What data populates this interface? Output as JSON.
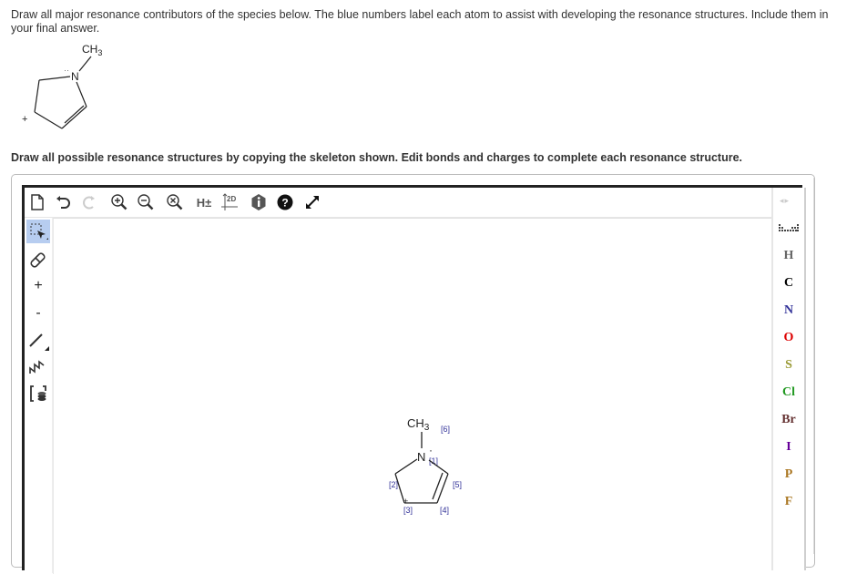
{
  "question": {
    "prompt": "Draw all major resonance contributors of the species below. The blue numbers label each atom to assist with developing the resonance structures. Include them in your final answer.",
    "molecule": {
      "methyl_label": "CH",
      "methyl_sub": "3",
      "nitrogen_label": "N",
      "lone_pair": "··",
      "charge_label": "+"
    }
  },
  "instruction": "Draw all possible resonance structures by copying the skeleton shown. Edit bonds and charges to complete each resonance structure.",
  "editor": {
    "toolbar": [
      {
        "name": "new-document-icon",
        "label": ""
      },
      {
        "name": "undo-icon",
        "label": ""
      },
      {
        "name": "redo-icon",
        "label": ""
      },
      {
        "name": "zoom-in-icon",
        "label": ""
      },
      {
        "name": "zoom-out-icon",
        "label": ""
      },
      {
        "name": "zoom-reset-icon",
        "label": ""
      },
      {
        "name": "toggle-hydrogens-button",
        "label": "H±"
      },
      {
        "name": "clean-2d-icon",
        "label": "2D"
      },
      {
        "name": "info-icon",
        "label": ""
      },
      {
        "name": "help-icon",
        "label": "?"
      },
      {
        "name": "fullscreen-icon",
        "label": ""
      }
    ],
    "left_tools": [
      {
        "name": "select-tool-icon",
        "label": "",
        "active": true
      },
      {
        "name": "eraser-tool-icon",
        "label": ""
      },
      {
        "name": "increase-charge-tool",
        "label": "+"
      },
      {
        "name": "decrease-charge-tool",
        "label": "-"
      },
      {
        "name": "bond-tool-icon",
        "label": ""
      },
      {
        "name": "chain-tool-icon",
        "label": ""
      },
      {
        "name": "template-tool-icon",
        "label": ""
      }
    ],
    "elements": [
      {
        "symbol": "H",
        "color": "#666666"
      },
      {
        "symbol": "C",
        "color": "#000000"
      },
      {
        "symbol": "N",
        "color": "#333399"
      },
      {
        "symbol": "O",
        "color": "#dd0000"
      },
      {
        "symbol": "S",
        "color": "#999933"
      },
      {
        "symbol": "Cl",
        "color": "#229922"
      },
      {
        "symbol": "Br",
        "color": "#663333"
      },
      {
        "symbol": "I",
        "color": "#660099"
      },
      {
        "symbol": "P",
        "color": "#aa7722"
      },
      {
        "symbol": "F",
        "color": "#aa7722"
      }
    ],
    "canvas_molecule": {
      "methyl_label": "CH",
      "methyl_sub": "3",
      "nitrogen_label": "N",
      "radical_dot": "·",
      "charge_label": "+",
      "atom_labels": [
        "[1]",
        "[2]",
        "[3]",
        "[4]",
        "[5]",
        "[6]"
      ],
      "label_color": "#333399"
    }
  }
}
